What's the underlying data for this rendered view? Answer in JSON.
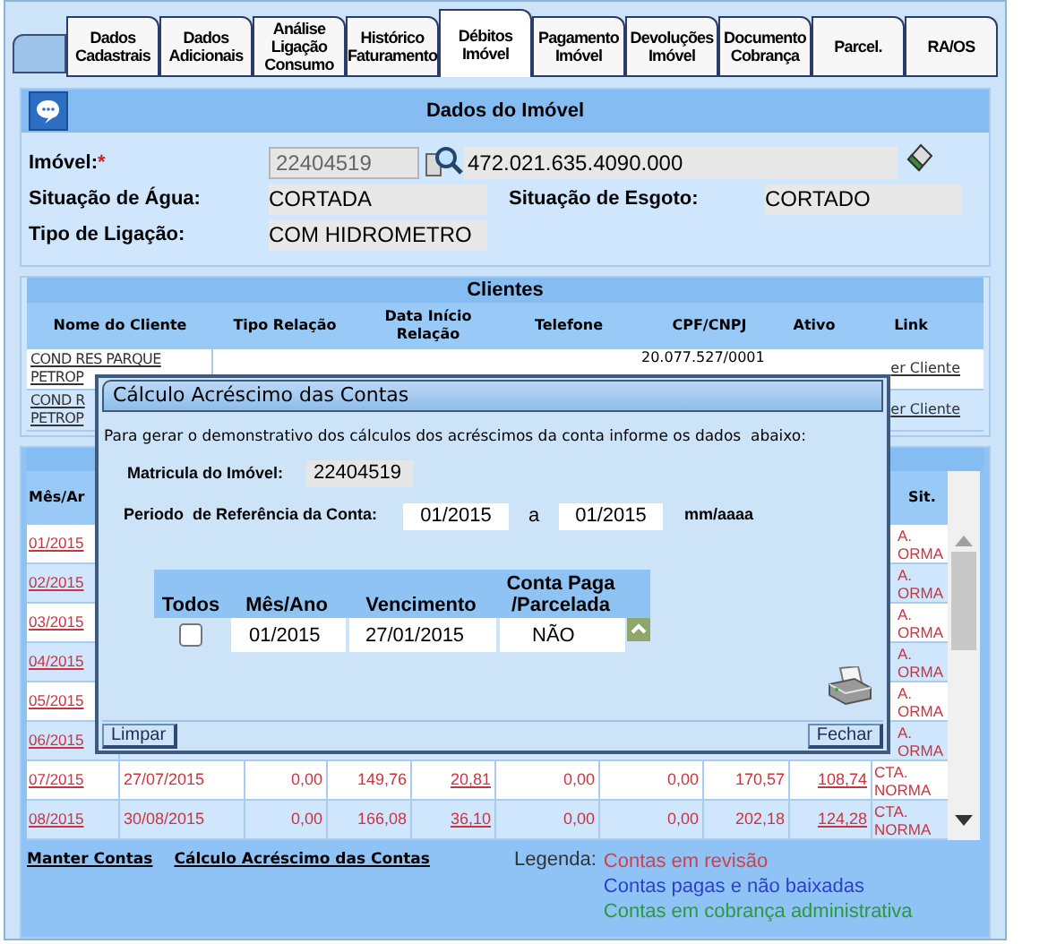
{
  "tabs": [
    {
      "label": "Dados Cadastrais",
      "selected": false
    },
    {
      "label": "Dados Adicionais",
      "selected": false
    },
    {
      "label": "Análise Ligação Consumo",
      "selected": false
    },
    {
      "label": "Histórico Faturamento",
      "selected": false
    },
    {
      "label": "Débitos Imóvel",
      "selected": true
    },
    {
      "label": "Pagamento Imóvel",
      "selected": false
    },
    {
      "label": "Devoluções Imóvel",
      "selected": false
    },
    {
      "label": "Documento Cobrança",
      "selected": false
    },
    {
      "label": "Parcel.",
      "selected": false
    },
    {
      "label": "RA/OS",
      "selected": false
    }
  ],
  "property": {
    "title": "Dados do Imóvel",
    "imovel_label": "Imóvel:",
    "required_mark": "*",
    "imovel_value": "22404519",
    "address_value": "472.021.635.4090.000",
    "water_label": "Situação de Água:",
    "water_value": "CORTADA",
    "sewer_label": "Situação de Esgoto:",
    "sewer_value": "CORTADO",
    "connection_label": "Tipo de Ligação:",
    "connection_value": "COM HIDROMETRO"
  },
  "clients": {
    "title": "Clientes",
    "columns": [
      "Nome do Cliente",
      "Tipo Relação",
      "Data Início Relação",
      "Telefone",
      "CPF/CNPJ",
      "Ativo",
      "Link"
    ],
    "rows": [
      {
        "name_lines": [
          "COND RES PARQUE",
          "PETROP"
        ],
        "cpf": "20.077.527/0001",
        "link": "er Cliente"
      },
      {
        "name_lines": [
          "COND R",
          "PETROP"
        ],
        "link": "er Cliente"
      }
    ]
  },
  "debts": {
    "first_header": "Mês/Ar",
    "last_header": "Sit.",
    "rows": [
      {
        "month": "01/2015",
        "sit": [
          "A.",
          "ORMA"
        ]
      },
      {
        "month": "02/2015",
        "sit": [
          "A.",
          "ORMA"
        ]
      },
      {
        "month": "03/2015",
        "sit": [
          "A.",
          "ORMA"
        ]
      },
      {
        "month": "04/2015",
        "sit": [
          "A.",
          "ORMA"
        ]
      },
      {
        "month": "05/2015",
        "sit": [
          "A.",
          "ORMA"
        ]
      },
      {
        "month": "06/2015",
        "sit": [
          "A.",
          "ORMA"
        ]
      },
      {
        "month": "07/2015",
        "due": "27/07/2015",
        "values": [
          {
            "text": "0,00",
            "link": false
          },
          {
            "text": "149,76",
            "link": false
          },
          {
            "text": "20,81",
            "link": true
          },
          {
            "text": "0,00",
            "link": false
          },
          {
            "text": "0,00",
            "link": false
          },
          {
            "text": "170,57",
            "link": false
          },
          {
            "text": "108,74",
            "link": true
          }
        ],
        "sit": [
          "CTA.",
          "NORMA"
        ]
      },
      {
        "month": "08/2015",
        "due": "30/08/2015",
        "values": [
          {
            "text": "0,00",
            "link": false
          },
          {
            "text": "166,08",
            "link": false
          },
          {
            "text": "36,10",
            "link": true
          },
          {
            "text": "0,00",
            "link": false
          },
          {
            "text": "0,00",
            "link": false
          },
          {
            "text": "202,18",
            "link": false
          },
          {
            "text": "124,28",
            "link": true
          }
        ],
        "sit": [
          "CTA.",
          "NORMA"
        ]
      }
    ]
  },
  "footer": {
    "links": [
      "Manter Contas",
      "Cálculo Acréscimo das Contas"
    ],
    "legend_label": "Legenda:",
    "legend": [
      {
        "text": "Contas em revisão",
        "color": "#d0404a"
      },
      {
        "text": "Contas pagas e não baixadas",
        "color": "#2a3fd0"
      },
      {
        "text": "Contas em cobrança administrativa",
        "color": "#2a9a3a"
      }
    ]
  },
  "dialog": {
    "title": "Cálculo Acréscimo das Contas",
    "intro": "Para gerar o demonstrativo dos cálculos dos acréscimos da conta informe os dados  abaixo:",
    "matricula_label": "Matricula do Imóvel:",
    "matricula_value": "22404519",
    "period_label": "Periodo  de Referência da Conta:",
    "period_from": "01/2015",
    "period_sep": "a",
    "period_to": "01/2015",
    "period_hint": "mm/aaaa",
    "table": {
      "columns": [
        "Todos",
        "Mês/Ano",
        "Vencimento",
        "Conta Paga /Parcelada"
      ],
      "rows": [
        {
          "checked": false,
          "month": "01/2015",
          "due": "27/01/2015",
          "paid": "NÃO"
        }
      ]
    },
    "buttons": [
      "Limpar",
      "Fechar"
    ]
  }
}
